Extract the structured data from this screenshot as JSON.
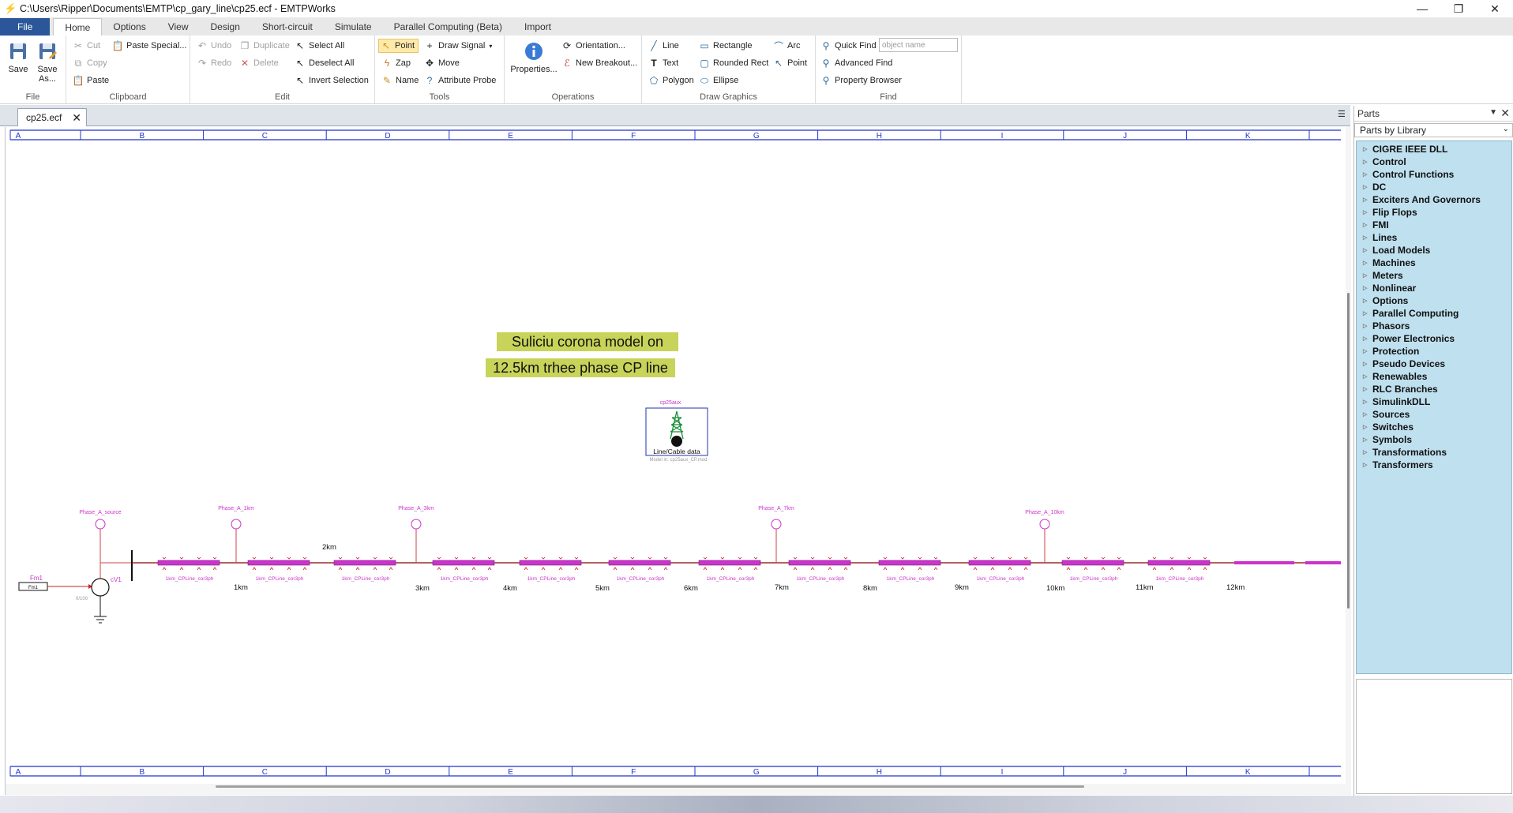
{
  "window": {
    "title": "C:\\Users\\Ripper\\Documents\\EMTP\\cp_gary_line\\cp25.ecf - EMTPWorks",
    "controls": {
      "minimize": "—",
      "maximize": "❐",
      "close": "✕"
    }
  },
  "ribbon_tabs": [
    "File",
    "Home",
    "Options",
    "View",
    "Design",
    "Short-circuit",
    "Simulate",
    "Parallel Computing (Beta)",
    "Import"
  ],
  "ribbon": {
    "file_group": {
      "save": "Save",
      "save_as_1": "Save",
      "save_as_2": "As...",
      "label": "File"
    },
    "clipboard": {
      "cut": "Cut",
      "copy": "Copy",
      "paste": "Paste",
      "paste_special": "Paste Special...",
      "label": "Clipboard"
    },
    "edit": {
      "undo": "Undo",
      "redo": "Redo",
      "duplicate": "Duplicate",
      "delete": "Delete",
      "select_all": "Select All",
      "deselect_all": "Deselect All",
      "invert_selection": "Invert Selection",
      "label": "Edit"
    },
    "tools": {
      "point": "Point",
      "zap": "Zap",
      "name": "Name",
      "draw_signal": "Draw Signal",
      "move": "Move",
      "attribute_probe": "Attribute Probe",
      "label": "Tools"
    },
    "operations": {
      "properties": "Properties...",
      "orientation": "Orientation...",
      "new_breakout": "New Breakout...",
      "label": "Operations"
    },
    "draw_graphics": {
      "line": "Line",
      "text": "Text",
      "polygon": "Polygon",
      "rectangle": "Rectangle",
      "rounded_rect": "Rounded Rect",
      "ellipse": "Ellipse",
      "arc": "Arc",
      "point": "Point",
      "label": "Draw Graphics"
    },
    "find": {
      "quick_find": "Quick Find",
      "placeholder": "object name",
      "advanced_find": "Advanced Find",
      "property_browser": "Property Browser",
      "label": "Find"
    }
  },
  "doc_tab": {
    "name": "cp25.ecf",
    "close": "✕"
  },
  "canvas": {
    "columns": [
      "A",
      "B",
      "C",
      "D",
      "E",
      "F",
      "G",
      "H",
      "I",
      "J",
      "K"
    ],
    "title_line1": "Suliciu corona model on",
    "title_line2": "12.5km trhee phase CP line",
    "line_data_block": {
      "top": "cp25aux",
      "label": "Line/Cable data",
      "bottom": "Model in: cp25aux_CP.mod"
    },
    "source": {
      "fm_label": "Fm1",
      "fm_value": "Fm1",
      "cv_label": "cV1",
      "cv_sub": "0/100",
      "probe": "Phase_A_source"
    },
    "probes": [
      "Phase_A_1km",
      "Phase_A_3km",
      "Phase_A_7km",
      "Phase_A_10km"
    ],
    "segment_label": "1km_CPLine_cor3ph",
    "distance_labels": [
      "2km",
      "1km",
      "3km",
      "4km",
      "5km",
      "6km",
      "7km",
      "8km",
      "9km",
      "10km",
      "11km",
      "12km"
    ],
    "wire_color": "#8b0000",
    "segment_color": "#cc33cc",
    "highlight_color": "#c8d35a"
  },
  "parts_panel": {
    "title": "Parts",
    "selector": "Parts by Library",
    "libraries": [
      "CIGRE IEEE DLL",
      "Control",
      "Control Functions",
      "DC",
      "Exciters And Governors",
      "Flip Flops",
      "FMI",
      "Lines",
      "Load Models",
      "Machines",
      "Meters",
      "Nonlinear",
      "Options",
      "Parallel Computing",
      "Phasors",
      "Power Electronics",
      "Protection",
      "Pseudo Devices",
      "Renewables",
      "RLC Branches",
      "SimulinkDLL",
      "Sources",
      "Switches",
      "Symbols",
      "Transformations",
      "Transformers"
    ]
  }
}
